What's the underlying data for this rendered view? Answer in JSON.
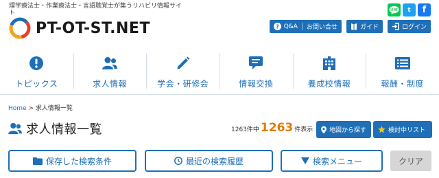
{
  "header": {
    "tagline": "理学療法士・作業療法士・言語聴覚士が集うリハビリ情報サイト",
    "logo_text": "PT-OT-ST.NET",
    "social": {
      "line": "LINE",
      "twitter": "t",
      "facebook": "f"
    },
    "buttons": {
      "qa": "Q&A",
      "contact": "お問い合せ",
      "guide": "ガイド",
      "login": "ログイン"
    }
  },
  "nav": {
    "items": [
      {
        "label": "トピックス",
        "icon": "exclamation-circle-icon"
      },
      {
        "label": "求人情報",
        "icon": "users-icon"
      },
      {
        "label": "学会・研修会",
        "icon": "pencil-icon"
      },
      {
        "label": "情報交換",
        "icon": "comment-icon"
      },
      {
        "label": "養成校情報",
        "icon": "building-icon"
      },
      {
        "label": "報酬・制度",
        "icon": "list-document-icon"
      }
    ]
  },
  "breadcrumb": {
    "home": "Home",
    "separator": ">",
    "current": "求人情報一覧"
  },
  "page": {
    "title": "求人情報一覧",
    "count_prefix": "1263件中",
    "count_big": "1263",
    "count_suffix": "件表示",
    "map_button": "地図から探す",
    "list_button": "検討中リスト"
  },
  "search": {
    "saved": "保存した検索条件",
    "history": "最近の検索履歴",
    "menu": "検索メニュー",
    "clear": "クリア"
  },
  "colors": {
    "brand": "#1e6fb7",
    "accent": "#e07b00",
    "clear_bg": "#d6d6d6"
  }
}
